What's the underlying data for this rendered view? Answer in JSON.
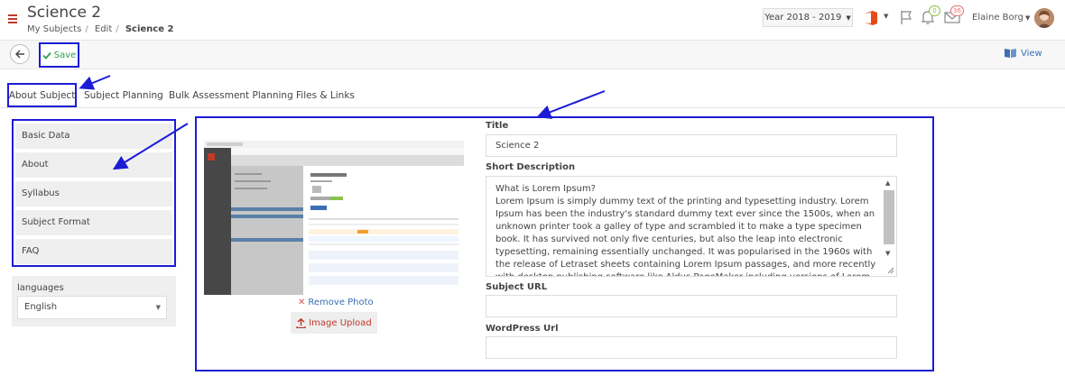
{
  "header": {
    "title": "Science 2",
    "breadcrumb": [
      "My Subjects",
      "Edit",
      "Science 2"
    ],
    "year_selector": "Year 2018 - 2019",
    "notifications_count": "0",
    "messages_count": "36",
    "user_name": "Elaine Borg"
  },
  "toolbar": {
    "save_label": "Save",
    "view_label": "View"
  },
  "tabs": [
    {
      "label": "About Subject"
    },
    {
      "label": "Subject Planning"
    },
    {
      "label": "Bulk Assessment Planning"
    },
    {
      "label": "Files & Links"
    }
  ],
  "sidebar": {
    "items": [
      {
        "label": "Basic Data"
      },
      {
        "label": "About"
      },
      {
        "label": "Syllabus"
      },
      {
        "label": "Subject Format"
      },
      {
        "label": "FAQ"
      }
    ],
    "languages_label": "languages",
    "language_value": "English"
  },
  "photo": {
    "remove_label": "Remove Photo",
    "upload_label": "Image Upload"
  },
  "form": {
    "title_label": "Title",
    "title_value": "Science 2",
    "short_description_label": "Short Description",
    "short_description_value": "What is Lorem Ipsum?\nLorem Ipsum is simply dummy text of the printing and typesetting industry. Lorem Ipsum has been the industry's standard dummy text ever since the 1500s, when an unknown printer took a galley of type and scrambled it to make a type specimen book. It has survived not only five centuries, but also the leap into electronic typesetting, remaining essentially unchanged. It was popularised in the 1960s with the release of Letraset sheets containing Lorem Ipsum passages, and more recently with desktop publishing software like Aldus PageMaker including versions of Lorem Ipsum.",
    "subject_url_label": "Subject URL",
    "subject_url_value": "",
    "wordpress_url_label": "WordPress Url",
    "wordpress_url_value": ""
  },
  "colors": {
    "annotation_blue": "#1c1cd6",
    "save_green": "#2e9e4f",
    "link_blue": "#3a6fb5",
    "brand_red": "#c0392b"
  }
}
